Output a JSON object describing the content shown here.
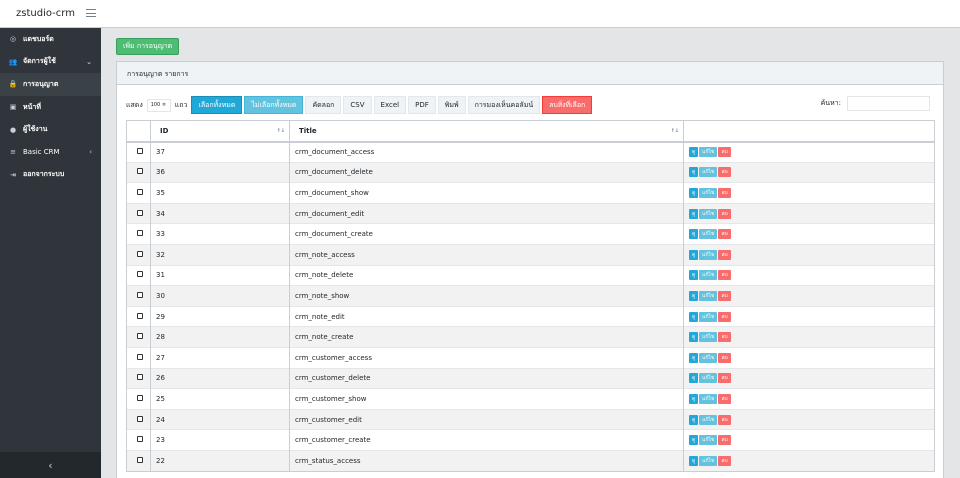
{
  "brand": "zstudio-crm",
  "sidebar": {
    "items": [
      {
        "label": "แดชบอร์ด",
        "icon": "dashboard-icon",
        "glyph": "◎"
      },
      {
        "label": "จัดการผู้ใช้",
        "icon": "users-icon",
        "glyph": "👥",
        "chevron": "⌄"
      },
      {
        "label": "การอนุญาต",
        "icon": "lock-icon",
        "glyph": "🔒"
      },
      {
        "label": "หน้าที่",
        "icon": "briefcase-icon",
        "glyph": "▣"
      },
      {
        "label": "ผู้ใช้งาน",
        "icon": "user-icon",
        "glyph": "●"
      },
      {
        "label": "Basic CRM",
        "icon": "menu-icon",
        "glyph": "≡",
        "chevron": "‹"
      },
      {
        "label": "ออกจากระบบ",
        "icon": "logout-icon",
        "glyph": "⇥"
      }
    ],
    "toggle": "‹"
  },
  "main": {
    "add_button": "เพิ่ม การอนุญาต",
    "card_title": "การอนุญาต รายการ",
    "toolbar": {
      "show_label": "แสดง",
      "page_size": "100 ≑",
      "rows_label": "แถว",
      "select_all": "เลือกทั้งหมด",
      "deselect_all": "ไม่เลือกทั้งหมด",
      "copy": "คัดลอก",
      "csv": "CSV",
      "excel": "Excel",
      "pdf": "PDF",
      "print": "พิมพ์",
      "colvis": "การมองเห็นคอลัมน์",
      "delete_selected": "ลบสิ่งที่เลือก"
    },
    "search_label": "ค้นหา:",
    "table": {
      "headers": {
        "id": "ID",
        "title": "Title"
      },
      "sort_id": "↑↓",
      "sort_title": "↑↓",
      "actions": {
        "view": "ดู",
        "edit": "แก้ไข",
        "delete": "ลบ"
      },
      "rows": [
        {
          "id": "37",
          "title": "crm_document_access"
        },
        {
          "id": "36",
          "title": "crm_document_delete"
        },
        {
          "id": "35",
          "title": "crm_document_show"
        },
        {
          "id": "34",
          "title": "crm_document_edit"
        },
        {
          "id": "33",
          "title": "crm_document_create"
        },
        {
          "id": "32",
          "title": "crm_note_access"
        },
        {
          "id": "31",
          "title": "crm_note_delete"
        },
        {
          "id": "30",
          "title": "crm_note_show"
        },
        {
          "id": "29",
          "title": "crm_note_edit"
        },
        {
          "id": "28",
          "title": "crm_note_create"
        },
        {
          "id": "27",
          "title": "crm_customer_access"
        },
        {
          "id": "26",
          "title": "crm_customer_delete"
        },
        {
          "id": "25",
          "title": "crm_customer_show"
        },
        {
          "id": "24",
          "title": "crm_customer_edit"
        },
        {
          "id": "23",
          "title": "crm_customer_create"
        },
        {
          "id": "22",
          "title": "crm_status_access"
        }
      ]
    }
  }
}
